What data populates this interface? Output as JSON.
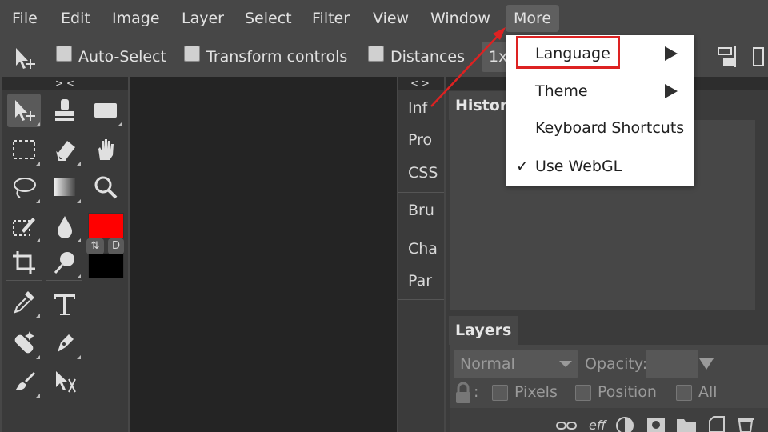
{
  "menubar": {
    "items": [
      {
        "label": "File"
      },
      {
        "label": "Edit"
      },
      {
        "label": "Image"
      },
      {
        "label": "Layer"
      },
      {
        "label": "Select"
      },
      {
        "label": "Filter"
      },
      {
        "label": "View"
      },
      {
        "label": "Window"
      },
      {
        "label": "More"
      }
    ]
  },
  "options": {
    "auto_select": "Auto-Select",
    "transform_controls": "Transform controls",
    "distances": "Distances",
    "zoom": "1x"
  },
  "toolbox": {
    "collapse_label": "> <",
    "swap_label": "⇅",
    "default_label": "D",
    "foreground_color": "#ff0000",
    "background_color": "#000000"
  },
  "middle_panel": {
    "collapse_label": "< >",
    "items": [
      "Inf",
      "Pro",
      "CSS",
      "Bru",
      "Cha",
      "Par"
    ]
  },
  "panels": {
    "history_title": "History",
    "layers_title": "Layers",
    "blend_mode": "Normal",
    "opacity_label": "Opacity:",
    "lock_colon": ":",
    "lock_pixels": "Pixels",
    "lock_position": "Position",
    "lock_all": "All",
    "effects_label": "eff"
  },
  "dropdown": {
    "items": [
      {
        "label": "Language",
        "submenu": true
      },
      {
        "label": "Theme",
        "submenu": true
      },
      {
        "label": "Keyboard Shortcuts",
        "submenu": false
      },
      {
        "label": "Use WebGL",
        "checked": true,
        "check_mark": "✓"
      }
    ]
  },
  "annotation": {
    "highlight_color": "#dd2222"
  }
}
